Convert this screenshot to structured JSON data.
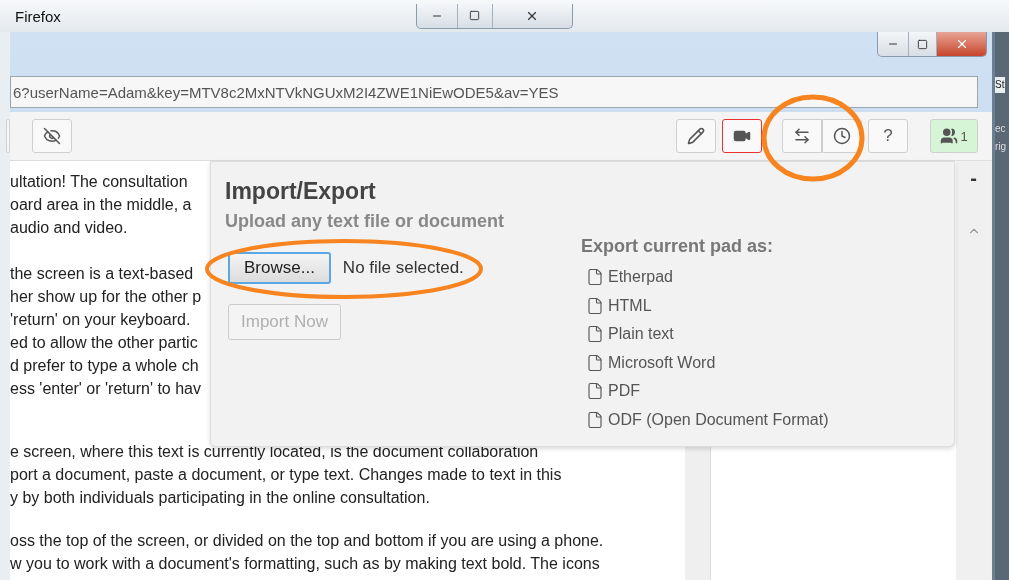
{
  "background_window": {
    "title": "Firefox"
  },
  "window": {
    "address": "6?userName=Adam&key=MTV8c2MxNTVkNGUxM2I4ZWE1NiEwODE5&av=YES"
  },
  "toolbar": {
    "users_count": "1",
    "help": "?"
  },
  "document": {
    "paragraphs": [
      {
        "lines": [
          "ultation! The consultation",
          "oard area in the middle, a",
          "audio and video."
        ]
      },
      {
        "lines": [
          "the screen is a text-based",
          "her show up for the other p",
          "'return' on your keyboard.",
          "ed to allow the other partic",
          "d prefer to type a whole ch",
          "ess 'enter' or 'return' to hav"
        ]
      },
      {
        "lines": [
          "e screen, where this text is currently located, is the document collaboration",
          "port a document, paste a document, or type text. Changes made to text in this",
          "y by both individuals participating in the online consultation."
        ]
      },
      {
        "lines": [
          "oss the top of the screen, or divided on the top and bottom if you are using a phone.",
          "w you to work with a document's formatting, such as by making text bold. The icons"
        ]
      }
    ]
  },
  "import_export": {
    "title": "Import/Export",
    "subtitle": "Upload any text file or document",
    "browse_button": "Browse...",
    "file_status": "No file selected.",
    "import_button": {
      "label": "Import Now",
      "disabled": true
    },
    "export_heading": "Export current pad as:",
    "export_options": [
      "Etherpad",
      "HTML",
      "Plain text",
      "Microsoft Word",
      "PDF",
      "ODF (Open Document Format)"
    ]
  },
  "side_panel": {
    "collapse": "-"
  },
  "edge_texts": [
    "St",
    "ec",
    "rig"
  ]
}
